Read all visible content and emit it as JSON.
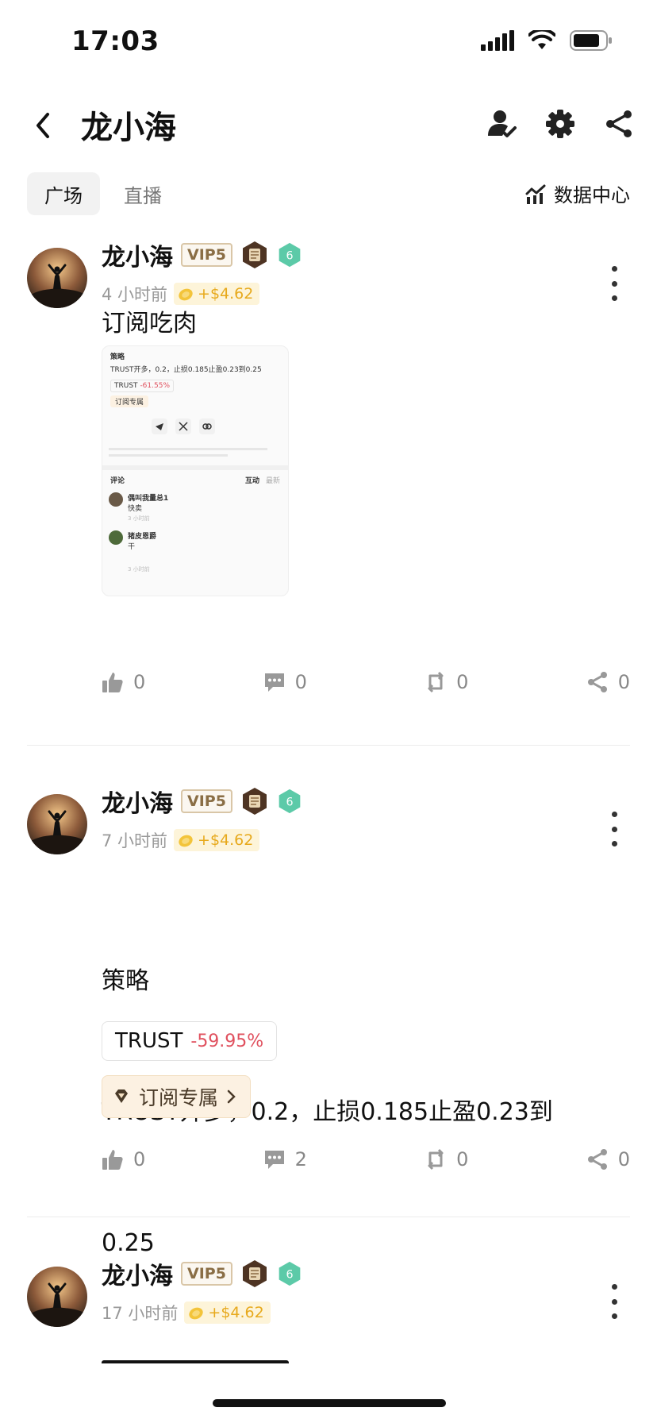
{
  "status": {
    "time": "17:03"
  },
  "header": {
    "title": "龙小海"
  },
  "tabs": [
    {
      "label": "广场",
      "active": true
    },
    {
      "label": "直播",
      "active": false
    }
  ],
  "data_center": {
    "label": "数据中心"
  },
  "posts": [
    {
      "author": "龙小海",
      "vip": "VIP5",
      "level": "6",
      "time": "4 小时前",
      "tip": "+$4.62",
      "text": "订阅吃肉",
      "thumbnail": {
        "title": "策略",
        "line": "TRUST开多，0.2，止损0.185止盈0.23到0.25",
        "coin": "TRUST",
        "coin_change": "-61.55%",
        "subscribe": "订阅专属",
        "comments_label": "评论",
        "tab_active": "互动",
        "tab_other": "最新",
        "commenters": [
          {
            "name": "偶叫我量总1",
            "text": "快卖",
            "time": "3 小时前"
          },
          {
            "name": "猪皮恩爵",
            "text": "干",
            "time": "3 小时前"
          }
        ]
      },
      "stats": {
        "likes": "0",
        "comments": "0",
        "reposts": "0",
        "shares": "0"
      }
    },
    {
      "author": "龙小海",
      "vip": "VIP5",
      "level": "6",
      "time": "7 小时前",
      "tip": "+$4.62",
      "text_lines": [
        "策略",
        "TRUST开多，0.2，止损0.185止盈0.23到",
        "0.25"
      ],
      "coin": {
        "name": "TRUST",
        "change": "-59.95%"
      },
      "subscribe": "订阅专属",
      "stats": {
        "likes": "0",
        "comments": "2",
        "reposts": "0",
        "shares": "0"
      }
    },
    {
      "author": "龙小海",
      "vip": "VIP5",
      "level": "6",
      "time": "17 小时前",
      "tip": "+$4.62"
    }
  ],
  "colors": {
    "vip_border": "#d9c6a7",
    "tip_bg": "#fdf4d9",
    "tip_text": "#e7a91c",
    "level_badge": "#5ccaa8",
    "negative_change": "#e0505e",
    "subscribe_bg": "#fcf1e2"
  },
  "icons": {
    "back": "chevron-left-icon",
    "profile": "user-check-icon",
    "settings": "gear-icon",
    "share": "share-icon",
    "data_center": "chart-icon",
    "like": "thumbs-up-icon",
    "comment": "comment-icon",
    "repost": "repost-icon",
    "more": "more-vertical-icon",
    "subscribe": "diamond-icon"
  }
}
